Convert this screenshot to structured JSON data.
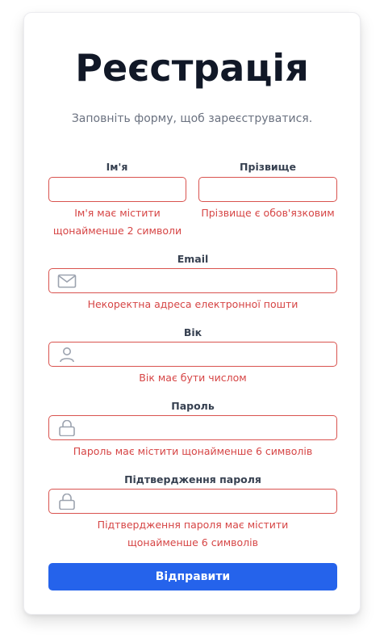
{
  "form": {
    "title": "Реєстрація",
    "subtitle": "Заповніть форму, щоб зареєструватися.",
    "first_name": {
      "label": "Ім'я",
      "value": "",
      "error": "Ім'я має містити щонайменше 2 символи"
    },
    "last_name": {
      "label": "Прізвище",
      "value": "",
      "error": "Прізвище є обов'язковим"
    },
    "email": {
      "label": "Email",
      "value": "",
      "icon": "mail-icon",
      "error": "Некоректна адреса електронної пошти"
    },
    "age": {
      "label": "Вік",
      "value": "",
      "icon": "user-icon",
      "error": "Вік має бути числом"
    },
    "password": {
      "label": "Пароль",
      "value": "",
      "icon": "lock-icon",
      "error": "Пароль має містити щонайменше 6 символів"
    },
    "password_confirm": {
      "label": "Підтвердження пароля",
      "value": "",
      "icon": "lock-icon",
      "error": "Підтвердження пароля має містити щонайменше 6 символів"
    },
    "submit_label": "Відправити"
  },
  "colors": {
    "accent": "#2563eb",
    "error": "#d64545",
    "title": "#111827"
  }
}
